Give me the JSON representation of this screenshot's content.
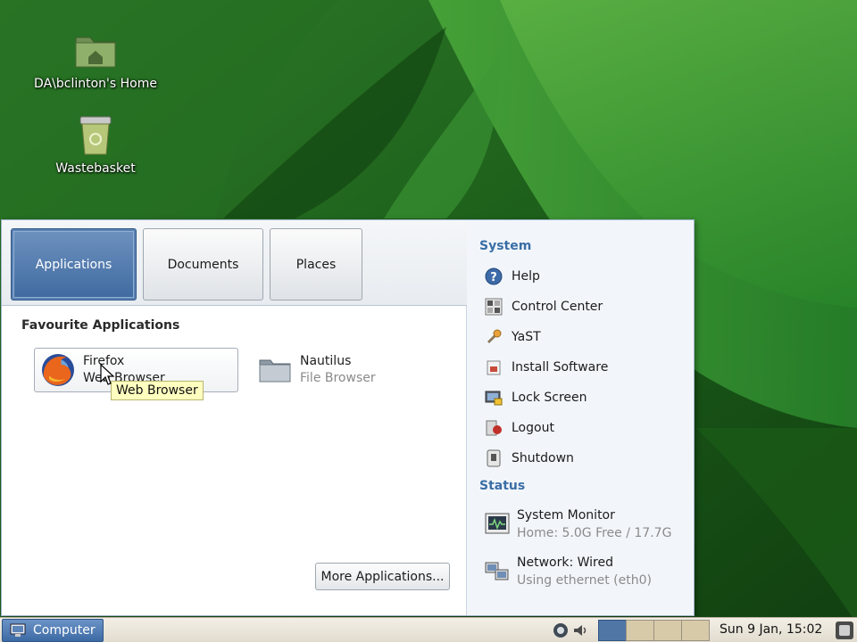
{
  "desktop": {
    "icons": [
      {
        "label": "DA\\bclinton's Home",
        "icon": "folder-home-icon"
      },
      {
        "label": "Wastebasket",
        "icon": "trash-icon"
      }
    ]
  },
  "menu": {
    "tabs": [
      {
        "label": "Applications",
        "active": true
      },
      {
        "label": "Documents",
        "active": false
      },
      {
        "label": "Places",
        "active": false
      }
    ],
    "favourites_title": "Favourite Applications",
    "apps": [
      {
        "name": "Firefox",
        "description": "Web Browser",
        "icon": "firefox-icon"
      },
      {
        "name": "Nautilus",
        "description": "File Browser",
        "icon": "folder-icon"
      }
    ],
    "tooltip": "Web Browser",
    "more_button": "More Applications...",
    "system": {
      "heading": "System",
      "items": [
        {
          "label": "Help",
          "icon": "help-icon"
        },
        {
          "label": "Control Center",
          "icon": "control-center-icon"
        },
        {
          "label": "YaST",
          "icon": "yast-icon"
        },
        {
          "label": "Install Software",
          "icon": "install-software-icon"
        },
        {
          "label": "Lock Screen",
          "icon": "lock-screen-icon"
        },
        {
          "label": "Logout",
          "icon": "logout-icon"
        },
        {
          "label": "Shutdown",
          "icon": "shutdown-icon"
        }
      ]
    },
    "status": {
      "heading": "Status",
      "items": [
        {
          "title": "System Monitor",
          "detail": "Home: 5.0G Free / 17.7G",
          "icon": "system-monitor-icon"
        },
        {
          "title": "Network: Wired",
          "detail": "Using ethernet (eth0)",
          "icon": "network-icon"
        }
      ]
    }
  },
  "taskbar": {
    "computer_label": "Computer",
    "clock": "Sun  9 Jan, 15:02",
    "workspaces": [
      true,
      false,
      false,
      false
    ]
  },
  "colors": {
    "accent": "#3f6aa0",
    "heading": "#3a6ea5",
    "tooltip_bg": "#ffffc0",
    "wallpaper_green": "#1f6a1f"
  }
}
